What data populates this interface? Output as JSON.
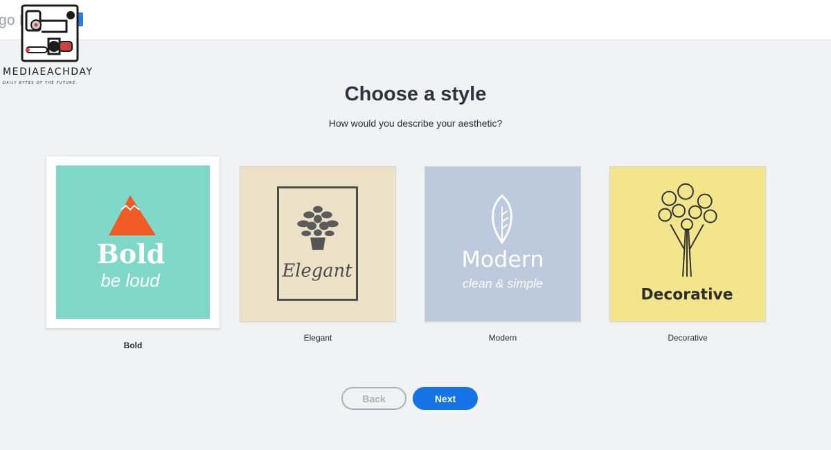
{
  "app": {
    "title": "go Maker"
  },
  "watermark": {
    "name": "MEDIAEACHDAY",
    "tagline": "DAILY BYTES OF THE FUTURE."
  },
  "page": {
    "heading": "Choose a style",
    "subheading": "How would you describe your aesthetic?"
  },
  "styles": [
    {
      "label": "Bold",
      "art_title": "Bold",
      "art_subtitle": "be loud",
      "bg": "#7fd8c8",
      "selected": true
    },
    {
      "label": "Elegant",
      "art_title": "Elegant",
      "bg": "#ede2c7",
      "selected": false
    },
    {
      "label": "Modern",
      "art_title": "Modern",
      "art_subtitle": "clean & simple",
      "bg": "#bdc9dc",
      "selected": false
    },
    {
      "label": "Decorative",
      "art_title": "Decorative",
      "bg": "#f3e58c",
      "selected": false
    }
  ],
  "buttons": {
    "back": "Back",
    "next": "Next"
  },
  "colors": {
    "accent": "#1473e6",
    "bold_mountain": "#f15a24"
  }
}
